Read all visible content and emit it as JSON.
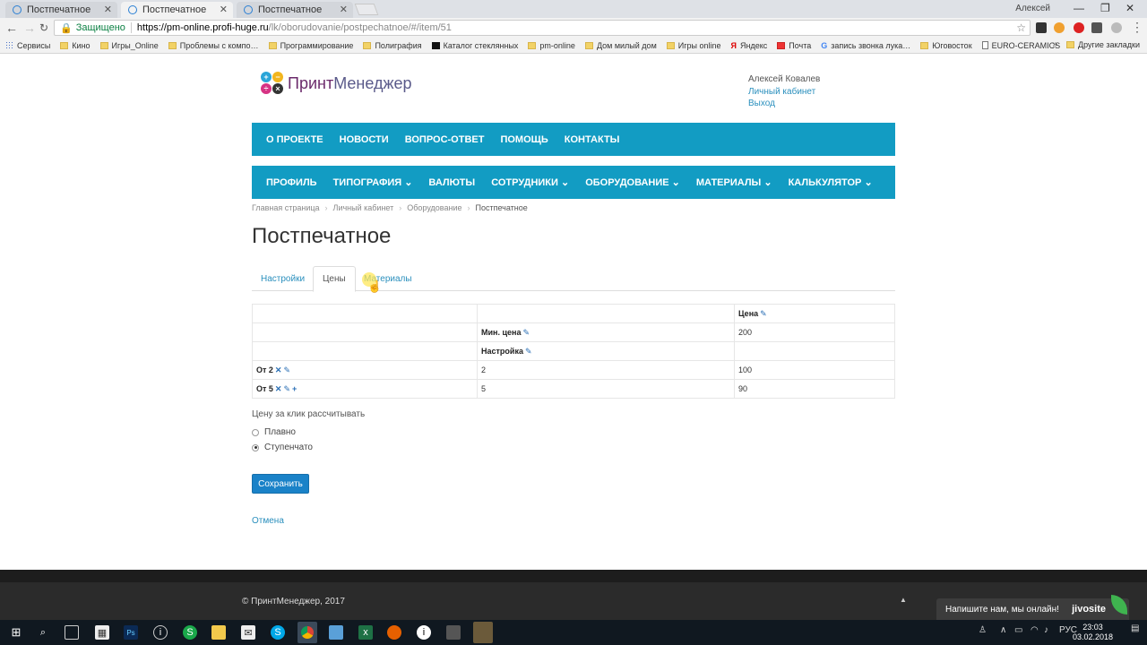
{
  "browser": {
    "tabs": [
      {
        "title": "Постпечатное",
        "active": false
      },
      {
        "title": "Постпечатное",
        "active": true
      },
      {
        "title": "Постпечатное",
        "active": false
      }
    ],
    "user": "Алексей",
    "secure_label": "Защищено",
    "url_host": "https://pm-online.profi-huge.ru",
    "url_path": "/lk/oborudovanie/postpechatnoe/#/item/51",
    "bookmarks": [
      {
        "label": "Сервисы",
        "icon": "apps"
      },
      {
        "label": "Кино",
        "icon": "folder"
      },
      {
        "label": "Игры_Online",
        "icon": "folder"
      },
      {
        "label": "Проблемы с компо…",
        "icon": "folder"
      },
      {
        "label": "Программирование",
        "icon": "folder"
      },
      {
        "label": "Полиграфия",
        "icon": "folder"
      },
      {
        "label": "Каталог стеклянных",
        "icon": "site"
      },
      {
        "label": "pm-online",
        "icon": "folder"
      },
      {
        "label": "Дом милый дом",
        "icon": "folder"
      },
      {
        "label": "Игры online",
        "icon": "folder"
      },
      {
        "label": "Яндекс",
        "icon": "yandex"
      },
      {
        "label": "Почта",
        "icon": "mail"
      },
      {
        "label": "запись звонка лука…",
        "icon": "google"
      },
      {
        "label": "Юговосток",
        "icon": "folder"
      },
      {
        "label": "EURO-CERAMICS",
        "icon": "page"
      }
    ],
    "other_bookmarks": "Другие закладки"
  },
  "site": {
    "logo_part1": "Принт",
    "logo_part2": "Менеджер",
    "user_name": "Алексей Ковалев",
    "cabinet_link": "Личный кабинет",
    "logout_link": "Выход",
    "top_nav": [
      "О ПРОЕКТЕ",
      "НОВОСТИ",
      "ВОПРОС-ОТВЕТ",
      "ПОМОЩЬ",
      "КОНТАКТЫ"
    ],
    "main_nav": [
      "ПРОФИЛЬ",
      "ТИПОГРАФИЯ ⌄",
      "ВАЛЮТЫ",
      "СОТРУДНИКИ ⌄",
      "ОБОРУДОВАНИЕ ⌄",
      "МАТЕРИАЛЫ ⌄",
      "КАЛЬКУЛЯТОР ⌄"
    ],
    "breadcrumb": [
      "Главная страница",
      "Личный кабинет",
      "Оборудование",
      "Постпечатное"
    ],
    "page_title": "Постпечатное",
    "tabs": [
      "Настройки",
      "Цены",
      "Материалы"
    ],
    "active_tab": "Цены",
    "table": {
      "header_price": "Цена",
      "min_price_label": "Мин. цена",
      "min_price_value": "200",
      "setup_label": "Настройка",
      "rows": [
        {
          "label": "От 2",
          "qty": "2",
          "price": "100"
        },
        {
          "label": "От 5",
          "qty": "5",
          "price": "90"
        }
      ]
    },
    "calc_label": "Цену за клик рассчитывать",
    "radio_options": [
      {
        "label": "Плавно",
        "checked": false
      },
      {
        "label": "Ступенчато",
        "checked": true
      }
    ],
    "save_button": "Сохранить",
    "cancel_link": "Отмена",
    "footer_copy": "© ПринтМенеджер, 2017",
    "jivo_text": "Напишите нам, мы онлайн!",
    "jivo_brand": "jivosite"
  },
  "taskbar": {
    "lang": "РУС",
    "time": "23:03",
    "date": "03.02.2018"
  }
}
